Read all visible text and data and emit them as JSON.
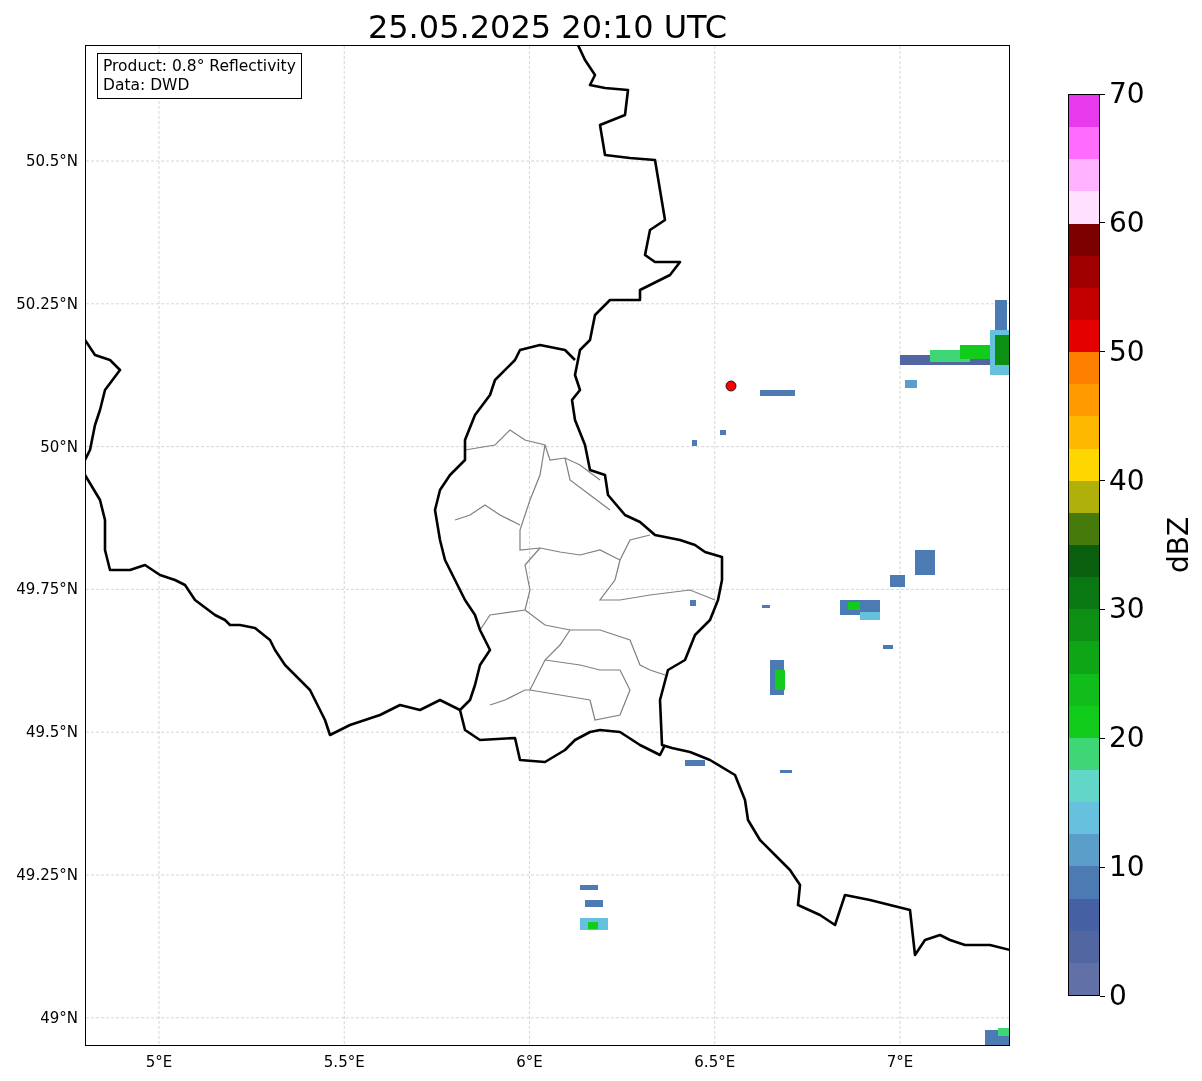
{
  "title": "25.05.2025 20:10 UTC",
  "map": {
    "info_lines": [
      "Product: 0.8° Reflectivity",
      "Data: DWD"
    ],
    "yticks": [
      "50.5°N",
      "50.25°N",
      "50°N",
      "49.75°N",
      "49.5°N",
      "49.25°N",
      "49°N"
    ],
    "xticks": [
      "5°E",
      "5.5°E",
      "6°E",
      "6.5°E",
      "7°E"
    ]
  },
  "colorbar": {
    "label": "dBZ",
    "ticks": [
      "70",
      "60",
      "50",
      "40",
      "30",
      "20",
      "10",
      "0"
    ],
    "bins": [
      {
        "color": "#e83aed"
      },
      {
        "color": "#ff6cff"
      },
      {
        "color": "#ffb2ff"
      },
      {
        "color": "#ffe0ff"
      },
      {
        "color": "#7d0000"
      },
      {
        "color": "#a10000"
      },
      {
        "color": "#c30000"
      },
      {
        "color": "#e50000"
      },
      {
        "color": "#ff7f00"
      },
      {
        "color": "#ff9a00"
      },
      {
        "color": "#ffb800"
      },
      {
        "color": "#ffd700"
      },
      {
        "color": "#b0b00a"
      },
      {
        "color": "#467a0b"
      },
      {
        "color": "#0a5f0e"
      },
      {
        "color": "#0a7812"
      },
      {
        "color": "#0c8f13"
      },
      {
        "color": "#0ea616"
      },
      {
        "color": "#10bd1a"
      },
      {
        "color": "#11cc1b"
      },
      {
        "color": "#3fd675"
      },
      {
        "color": "#63d7c7"
      },
      {
        "color": "#66c1de"
      },
      {
        "color": "#5b9ec9"
      },
      {
        "color": "#4c7ab3"
      },
      {
        "color": "#4560a3"
      },
      {
        "color": "#5266a1"
      },
      {
        "color": "#6170a6"
      }
    ]
  }
}
